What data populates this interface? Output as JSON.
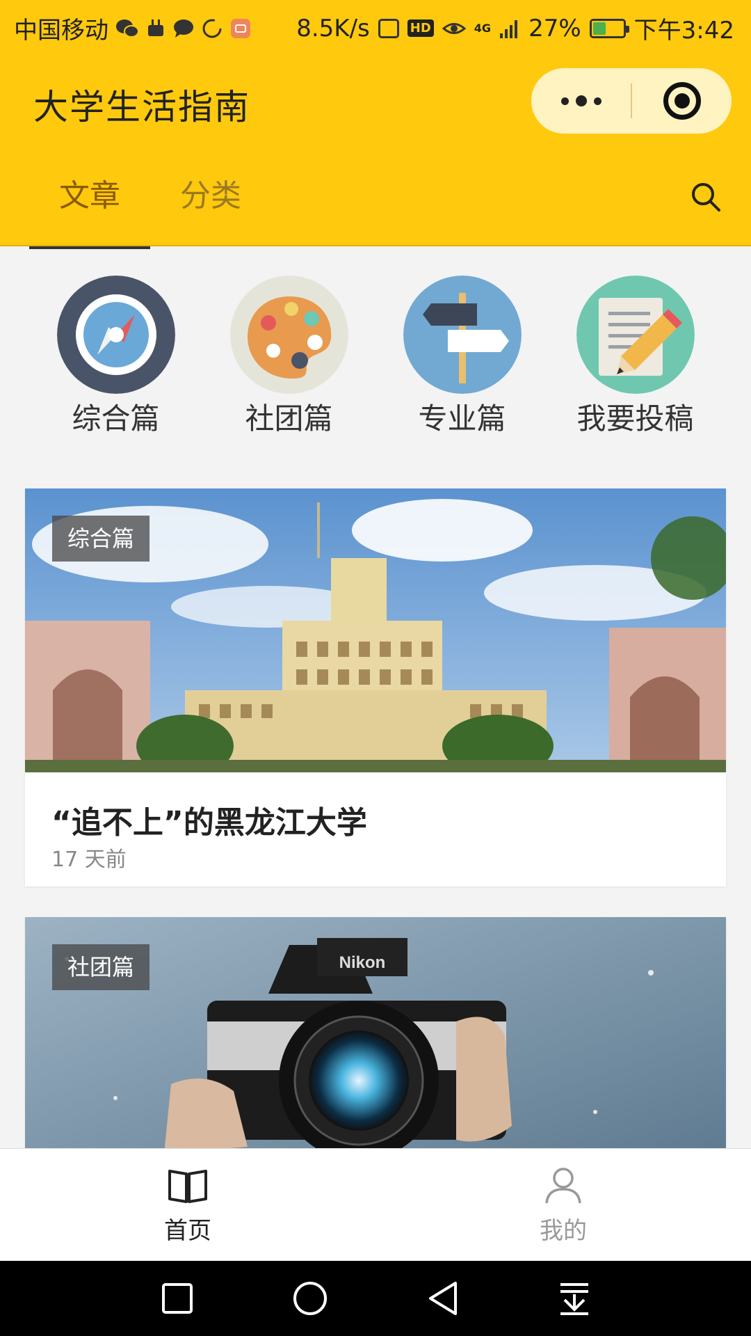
{
  "status_bar": {
    "carrier": "中国移动",
    "speed": "8.5K/s",
    "hd": "HD",
    "network": "4G",
    "battery": "27%",
    "time": "下午3:42"
  },
  "header": {
    "title": "大学生活指南",
    "tabs": [
      {
        "label": "文章",
        "active": true
      },
      {
        "label": "分类",
        "active": false
      }
    ]
  },
  "categories": [
    {
      "label": "综合篇",
      "icon": "compass-icon"
    },
    {
      "label": "社团篇",
      "icon": "palette-icon"
    },
    {
      "label": "专业篇",
      "icon": "signpost-icon"
    },
    {
      "label": "我要投稿",
      "icon": "edit-note-icon"
    }
  ],
  "articles": [
    {
      "tag": "综合篇",
      "title": "“追不上”的黑龙江大学",
      "time": "17 天前",
      "image": "university-building-photo"
    },
    {
      "tag": "社团篇",
      "image": "camera-photo"
    }
  ],
  "tabbar": [
    {
      "label": "首页",
      "icon": "book-icon",
      "active": true
    },
    {
      "label": "我的",
      "icon": "user-icon",
      "active": false
    }
  ],
  "colors": {
    "brand": "#ffc90e"
  }
}
